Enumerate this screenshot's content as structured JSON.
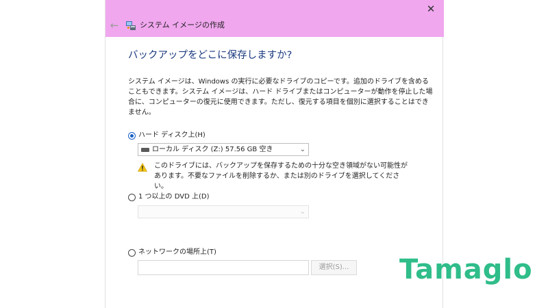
{
  "window": {
    "title": "システム イメージの作成",
    "back_label": "←",
    "close_label": "✕"
  },
  "content": {
    "heading": "バックアップをどこに保存しますか?",
    "description": "システム イメージは、Windows の実行に必要なドライブのコピーです。追加のドライブを含めることもできます。システム イメージは、ハード ドライブまたはコンピューターが動作を停止した場合に、コンピューターの復元に使用できます。ただし、復元する項目を個別に選択することはできません。"
  },
  "options": {
    "hard_disk": {
      "label": "ハード ディスク上(H)",
      "selected": true,
      "dropdown_value": "ローカル ディスク (Z:)  57.56 GB 空き",
      "warning": "このドライブには、バックアップを保存するための十分な空き領域がない可能性があります。不要なファイルを削除するか、または別のドライブを選択してください。"
    },
    "dvd": {
      "label": "1 つ以上の DVD 上(D)",
      "selected": false,
      "dropdown_value": ""
    },
    "network": {
      "label": "ネットワークの場所上(T)",
      "selected": false,
      "input_value": "",
      "browse_label": "選択(S)..."
    }
  },
  "watermark": {
    "text": "Tamaglo",
    "color": "#2fbd8a"
  },
  "colors": {
    "titlebar": "#f0a7ee",
    "heading": "#1b3a80",
    "accent": "#1760c7",
    "warning": "#f2c316"
  },
  "icons": {
    "app": "system-image-icon",
    "drive": "hard-drive-icon",
    "warning": "warning-icon"
  }
}
